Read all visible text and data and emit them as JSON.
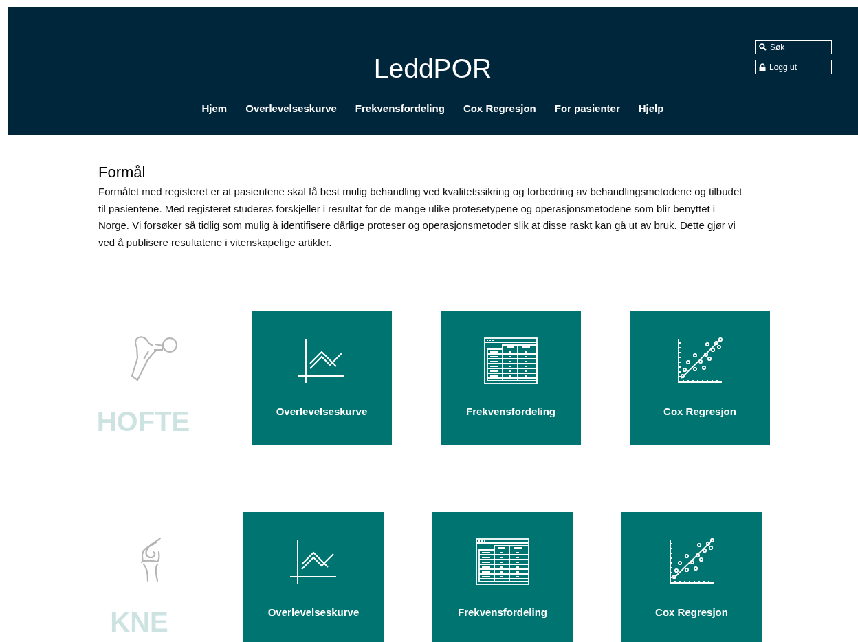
{
  "header": {
    "title": "LeddPOR",
    "search": {
      "label": "Søk"
    },
    "logout": {
      "label": "Logg ut"
    },
    "nav": [
      "Hjem",
      "Overlevelseskurve",
      "Frekvensfordeling",
      "Cox Regresjon",
      "For pasienter",
      "Hjelp"
    ]
  },
  "purpose": {
    "heading": "Formål",
    "text": "Formålet med registeret er at pasientene skal få best mulig behandling ved kvalitetssikring og forbedring av behandlingsmetodene og tilbudet til pasientene. Med registeret studeres forskjeller i resultat for de mange ulike protesetypene og operasjonsmetodene som blir benyttet i Norge. Vi forsøker så tidlig som mulig å identifisere dårlige proteser og operasjonsmetoder slik at disse raskt kan gå ut av bruk. Dette gjør vi ved å publisere resultatene i vitenskapelige artikler."
  },
  "joints": [
    {
      "label": "HOFTE",
      "kind": "hip",
      "tiles": [
        {
          "label": "Overlevelseskurve",
          "kind": "curve"
        },
        {
          "label": "Frekvensfordeling",
          "kind": "table"
        },
        {
          "label": "Cox Regresjon",
          "kind": "scatter"
        }
      ]
    },
    {
      "label": "KNE",
      "kind": "knee",
      "tiles": [
        {
          "label": "Overlevelseskurve",
          "kind": "curve"
        },
        {
          "label": "Frekvensfordeling",
          "kind": "table"
        },
        {
          "label": "Cox Regresjon",
          "kind": "scatter"
        }
      ]
    }
  ]
}
